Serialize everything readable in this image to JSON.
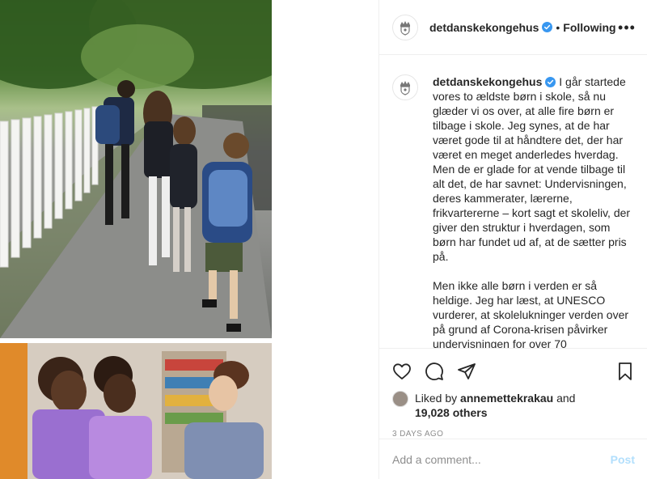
{
  "post": {
    "author": "detdanskekongehus",
    "follow_state": "Following",
    "separator": "•",
    "more_glyph": "•••",
    "caption_para1": "I går startede vores to ældste børn i skole, så nu glæder vi os over, at alle fire børn er tilbage i skole. Jeg synes, at de har været gode til at håndtere det, der har været en meget anderledes hverdag. Men de er glade for at vende tilbage til alt det, de har savnet: Undervisningen, deres kammerater, lærerne, frikvartererne – kort sagt et skoleliv, der giver den struktur i hverdagen, som børn har fundet ud af, at de sætter pris på.",
    "caption_para2": "Men ikke alle børn i verden er så heldige. Jeg har læst, at UNESCO vurderer, at skolelukninger verden over på grund af Corona-krisen påvirker undervisningen for over 70",
    "likes_prefix": "Liked by",
    "liked_by_user": "annemettekrakau",
    "likes_and": "and",
    "likes_count": "19,028 others",
    "timestamp": "3 DAYS AGO"
  },
  "comment": {
    "placeholder": "Add a comment...",
    "post_label": "Post"
  },
  "icons": {
    "verified": "verified-badge-icon",
    "like": "heart-icon",
    "comment": "comment-bubble-icon",
    "share": "paper-plane-icon",
    "save": "bookmark-icon",
    "more": "more-options-icon",
    "crest": "royal-crest-icon"
  },
  "colors": {
    "verified_blue": "#3897f0",
    "post_button_disabled": "#b2dffc",
    "text": "#262626",
    "muted": "#8e8e8e",
    "border": "#efefef"
  }
}
